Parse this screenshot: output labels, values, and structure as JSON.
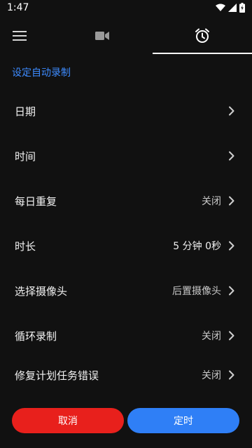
{
  "status_bar": {
    "time": "1:47",
    "icons": [
      "wifi-icon",
      "signal-icon",
      "battery-charging-icon"
    ]
  },
  "toolbar": {
    "icons": [
      "menu-icon",
      "video-camera-icon",
      "alarm-clock-icon"
    ],
    "active_tab": "alarm-clock-icon"
  },
  "section_title": "设定自动录制",
  "settings": [
    {
      "label": "日期",
      "value": ""
    },
    {
      "label": "时间",
      "value": ""
    },
    {
      "label": "每日重复",
      "value": "关闭"
    },
    {
      "label": "时长",
      "value": "5 分钟 0秒"
    },
    {
      "label": "选择摄像头",
      "value": "后置摄像头"
    },
    {
      "label": "循环录制",
      "value": "关闭"
    },
    {
      "label": "修复计划任务错误",
      "value": "关闭"
    }
  ],
  "buttons": {
    "cancel": "取消",
    "schedule": "定时"
  },
  "colors": {
    "background": "#111111",
    "accent_blue": "#3d8bff",
    "cancel_red": "#e8201c",
    "schedule_blue": "#2f7ff6"
  }
}
